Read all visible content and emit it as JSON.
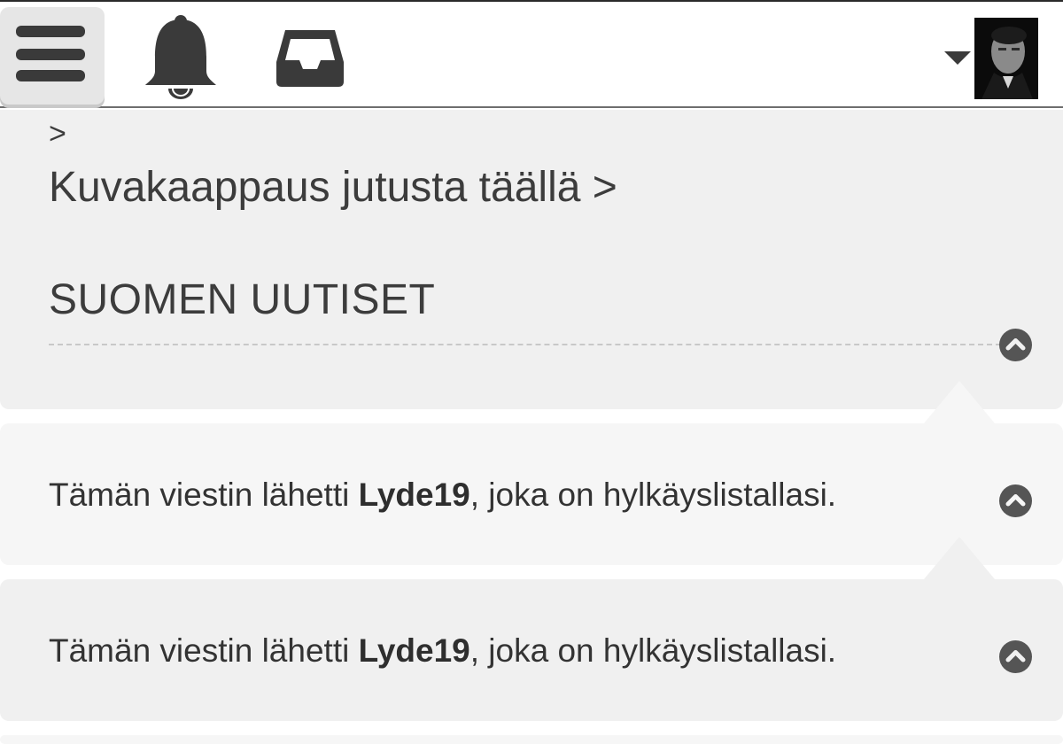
{
  "header": {
    "menu_icon": "hamburger-icon",
    "notifications_icon": "bell-icon",
    "inbox_icon": "inbox-tray-icon",
    "user_menu_icon": "caret-down-icon",
    "avatar_alt": "user avatar"
  },
  "breadcrumb": {
    "arrow": ">",
    "link_text": "Kuvakaappaus jutusta täällä >"
  },
  "section": {
    "title": "SUOMEN UUTISET",
    "toggle_icon": "chevron-up-icon"
  },
  "posts": [
    {
      "prefix": "Tämän viestin lähetti ",
      "author": "Lyde19",
      "suffix": ", joka on hylkäyslistallasi.",
      "toggle_icon": "chevron-up-icon"
    },
    {
      "prefix": "Tämän viestin lähetti ",
      "author": "Lyde19",
      "suffix": ", joka on hylkäyslistallasi.",
      "toggle_icon": "chevron-up-icon"
    }
  ],
  "colors": {
    "panel_bg": "#f0f0f0",
    "post_alt_bg": "#f6f6f6",
    "icon": "#3a3a3a",
    "text": "#333333"
  }
}
